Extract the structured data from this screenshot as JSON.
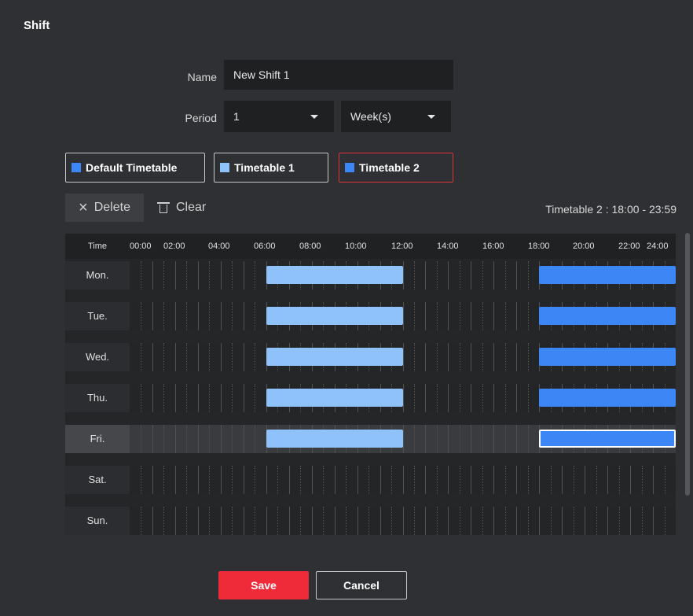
{
  "dialog": {
    "title": "Shift"
  },
  "form": {
    "name_label": "Name",
    "name_value": "New Shift 1",
    "period_label": "Period",
    "period_value": "1",
    "period_unit": "Week(s)"
  },
  "timetables": [
    {
      "label": "Default Timetable",
      "color": "#3d86f5",
      "selected": false
    },
    {
      "label": "Timetable 1",
      "color": "#8fc1fb",
      "selected": false
    },
    {
      "label": "Timetable 2",
      "color": "#3d86f5",
      "selected": true
    }
  ],
  "toolbar": {
    "delete_label": "Delete",
    "clear_label": "Clear",
    "selection_info": "Timetable 2 : 18:00 - 23:59"
  },
  "schedule": {
    "time_header": "Time",
    "tick_labels": [
      "00:00",
      "02:00",
      "04:00",
      "06:00",
      "08:00",
      "10:00",
      "12:00",
      "14:00",
      "16:00",
      "18:00",
      "20:00",
      "22:00",
      "24:00"
    ],
    "days": [
      {
        "label": "Mon.",
        "active": false,
        "segments": [
          {
            "start": 6,
            "end": 12,
            "timetable": 1
          },
          {
            "start": 18,
            "end": 24,
            "timetable": 2
          }
        ]
      },
      {
        "label": "Tue.",
        "active": false,
        "segments": [
          {
            "start": 6,
            "end": 12,
            "timetable": 1
          },
          {
            "start": 18,
            "end": 24,
            "timetable": 2
          }
        ]
      },
      {
        "label": "Wed.",
        "active": false,
        "segments": [
          {
            "start": 6,
            "end": 12,
            "timetable": 1
          },
          {
            "start": 18,
            "end": 24,
            "timetable": 2
          }
        ]
      },
      {
        "label": "Thu.",
        "active": false,
        "segments": [
          {
            "start": 6,
            "end": 12,
            "timetable": 1
          },
          {
            "start": 18,
            "end": 24,
            "timetable": 2
          }
        ]
      },
      {
        "label": "Fri.",
        "active": true,
        "segments": [
          {
            "start": 6,
            "end": 12,
            "timetable": 1
          },
          {
            "start": 18,
            "end": 24,
            "timetable": 2,
            "selected": true
          }
        ]
      },
      {
        "label": "Sat.",
        "active": false,
        "segments": []
      },
      {
        "label": "Sun.",
        "active": false,
        "segments": []
      }
    ]
  },
  "actions": {
    "save_label": "Save",
    "cancel_label": "Cancel"
  },
  "colors": {
    "accent": "#ef2b3a",
    "timetable2": "#3d86f5",
    "timetable1": "#8fc1fb"
  }
}
